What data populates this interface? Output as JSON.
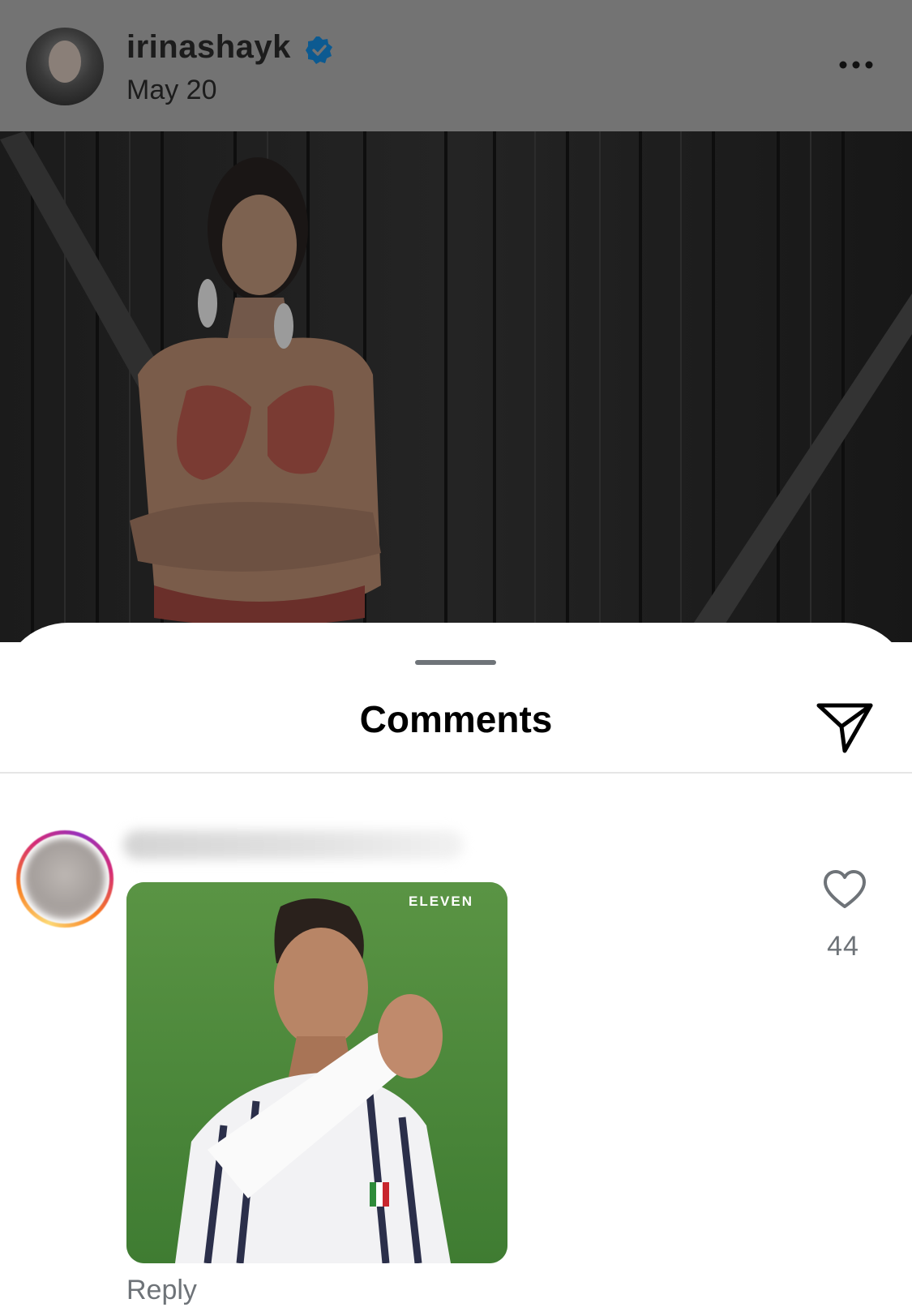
{
  "post": {
    "username": "irinashayk",
    "date": "May 20",
    "verified": true
  },
  "comments_sheet": {
    "title": "Comments",
    "comment": {
      "gif_watermark": "ELEVEN",
      "like_count": "44",
      "reply_label": "Reply"
    }
  },
  "colors": {
    "verified_blue": "#0095f6",
    "secondary_text": "#6e7378"
  },
  "icons": {
    "verified": "verified-badge-icon",
    "more": "more-dots-icon",
    "share": "paper-plane-icon",
    "like": "heart-outline-icon"
  }
}
